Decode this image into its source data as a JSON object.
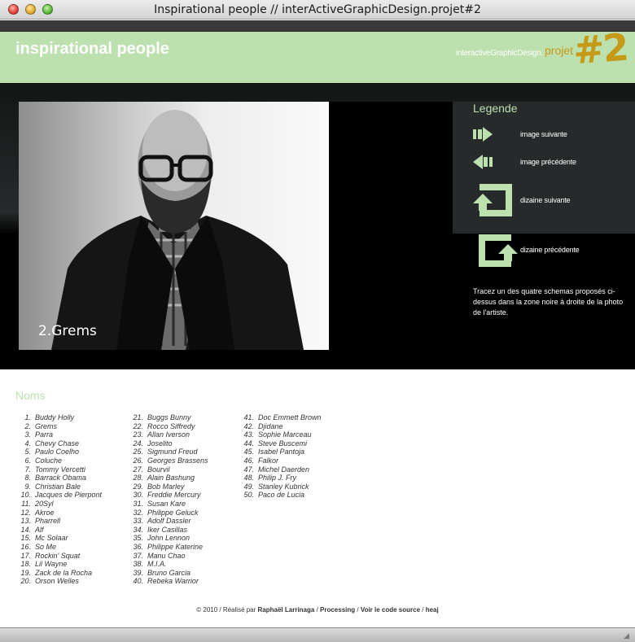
{
  "window": {
    "title": "Inspirational people // interActiveGraphicDesign.projet#2",
    "buttons": [
      "close",
      "minimize",
      "zoom"
    ]
  },
  "header": {
    "site_title": "inspirational people",
    "brand_label": "interactiveGraphicDesign.",
    "brand_projet": "projet",
    "brand_number": "#2"
  },
  "photo": {
    "caption": "2.Grems",
    "subject": "black-and-white portrait of a bald man with glasses and beard"
  },
  "legend": {
    "title": "Legende",
    "items": [
      {
        "icon": "arrow-right-icon",
        "label": "image suivante"
      },
      {
        "icon": "arrow-left-icon",
        "label": "image précédente"
      },
      {
        "icon": "loop-up-left-icon",
        "label": "dizaine suivante"
      },
      {
        "icon": "loop-up-right-icon",
        "label": "dizaine précédente"
      }
    ],
    "note": "Tracez un des quatre schemas proposés ci-dessus dans la zone noire à droite de la photo de l'artiste."
  },
  "names": {
    "title": "Noms",
    "columns": [
      [
        {
          "n": "1.",
          "name": "Buddy Holly"
        },
        {
          "n": "2.",
          "name": "Grems"
        },
        {
          "n": "3.",
          "name": "Parra"
        },
        {
          "n": "4.",
          "name": "Chevy Chase"
        },
        {
          "n": "5.",
          "name": "Paulo Coelho"
        },
        {
          "n": "6.",
          "name": "Coluche"
        },
        {
          "n": "7.",
          "name": "Tommy Vercetti"
        },
        {
          "n": "8.",
          "name": "Barrack Obama"
        },
        {
          "n": "9.",
          "name": "Christian Bale"
        },
        {
          "n": "10.",
          "name": "Jacques de Pierpont"
        },
        {
          "n": "11.",
          "name": "20Syl"
        },
        {
          "n": "12.",
          "name": "Akroe"
        },
        {
          "n": "13.",
          "name": "Pharrell"
        },
        {
          "n": "14.",
          "name": "Alf"
        },
        {
          "n": "15.",
          "name": "Mc Solaar"
        },
        {
          "n": "16.",
          "name": "So Me"
        },
        {
          "n": "17.",
          "name": "Rockin' Squat"
        },
        {
          "n": "18.",
          "name": "Lil Wayne"
        },
        {
          "n": "19.",
          "name": "Zack de la Rocha"
        },
        {
          "n": "20.",
          "name": "Orson Welles"
        }
      ],
      [
        {
          "n": "21.",
          "name": "Buggs Bunny"
        },
        {
          "n": "22.",
          "name": "Rocco Siffredy"
        },
        {
          "n": "23.",
          "name": "Allan Iverson"
        },
        {
          "n": "24.",
          "name": "Joselito"
        },
        {
          "n": "25.",
          "name": "Sigmund Freud"
        },
        {
          "n": "26.",
          "name": "Georges Brassens"
        },
        {
          "n": "27.",
          "name": "Bourvil"
        },
        {
          "n": "28.",
          "name": "Alain Bashung"
        },
        {
          "n": "29.",
          "name": "Bob Marley"
        },
        {
          "n": "30.",
          "name": "Freddie Mercury"
        },
        {
          "n": "31.",
          "name": "Susan Kare"
        },
        {
          "n": "32.",
          "name": "Philippe Geluck"
        },
        {
          "n": "33.",
          "name": "Adolf Dassler"
        },
        {
          "n": "34.",
          "name": "Iker Casillas"
        },
        {
          "n": "35.",
          "name": "John Lennon"
        },
        {
          "n": "36.",
          "name": "Philippe Katerine"
        },
        {
          "n": "37.",
          "name": "Manu Chao"
        },
        {
          "n": "38.",
          "name": "M.I.A."
        },
        {
          "n": "39.",
          "name": "Bruno Garcia"
        },
        {
          "n": "40.",
          "name": "Rebeka Warrior"
        }
      ],
      [
        {
          "n": "41.",
          "name": "Doc Emmett Brown"
        },
        {
          "n": "42.",
          "name": "Djidane"
        },
        {
          "n": "43.",
          "name": "Sophie Marceau"
        },
        {
          "n": "44.",
          "name": "Steve Buscemi"
        },
        {
          "n": "45.",
          "name": "Isabel Pantoja"
        },
        {
          "n": "46.",
          "name": "Falkor"
        },
        {
          "n": "47.",
          "name": "Michel Daerden"
        },
        {
          "n": "48.",
          "name": "Philip J. Fry"
        },
        {
          "n": "49.",
          "name": "Stanley Kubrick"
        },
        {
          "n": "50.",
          "name": "Paco de Lucia"
        }
      ]
    ]
  },
  "footer": {
    "prefix": "© 2010 / Réalisé par ",
    "author": "Raphaël Larrinaga",
    "sep1": " / ",
    "processing": "Processing",
    "sep2": " / ",
    "source": "Voir le code source",
    "sep3": " / ",
    "heaj": "heaj"
  },
  "colors": {
    "accent_green": "#bde0af",
    "brand_gold": "#c59a16",
    "stage_dark": "#262a2a"
  }
}
